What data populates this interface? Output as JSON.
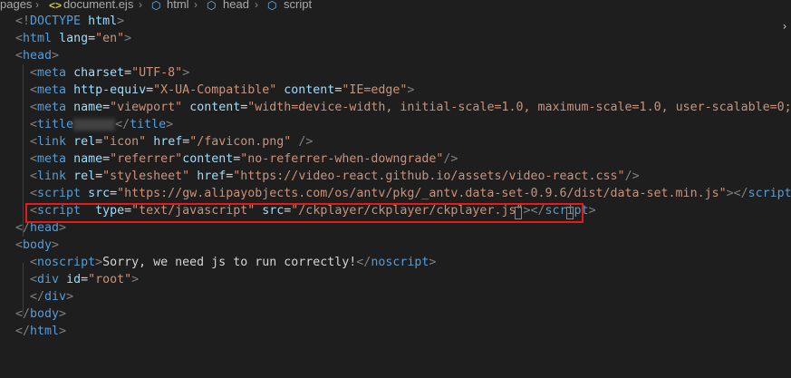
{
  "breadcrumb": {
    "items": [
      "pages",
      "document.ejs",
      "html",
      "head",
      "script"
    ],
    "separator": "›"
  },
  "code_lines": [
    [
      [
        "t-punct",
        "<!"
      ],
      [
        "t-tag",
        "DOCTYPE"
      ],
      [
        "t-text",
        " "
      ],
      [
        "t-attr",
        "html"
      ],
      [
        "t-punct",
        ">"
      ]
    ],
    [
      [
        "t-punct",
        "<"
      ],
      [
        "t-tag",
        "html"
      ],
      [
        "t-text",
        " "
      ],
      [
        "t-attr",
        "lang"
      ],
      [
        "t-text",
        "="
      ],
      [
        "t-str",
        "\"en\""
      ],
      [
        "t-punct",
        ">"
      ]
    ],
    [
      [
        "t-punct",
        "<"
      ],
      [
        "t-tag",
        "head"
      ],
      [
        "t-punct",
        ">"
      ]
    ],
    [
      [
        "t-text",
        "  "
      ],
      [
        "t-punct",
        "<"
      ],
      [
        "t-tag",
        "meta"
      ],
      [
        "t-text",
        " "
      ],
      [
        "t-attr",
        "charset"
      ],
      [
        "t-text",
        "="
      ],
      [
        "t-str",
        "\"UTF-8\""
      ],
      [
        "t-punct",
        ">"
      ]
    ],
    [
      [
        "t-text",
        "  "
      ],
      [
        "t-punct",
        "<"
      ],
      [
        "t-tag",
        "meta"
      ],
      [
        "t-text",
        " "
      ],
      [
        "t-attr",
        "http-equiv"
      ],
      [
        "t-text",
        "="
      ],
      [
        "t-str",
        "\"X-UA-Compatible\""
      ],
      [
        "t-text",
        " "
      ],
      [
        "t-attr",
        "content"
      ],
      [
        "t-text",
        "="
      ],
      [
        "t-str",
        "\"IE=edge\""
      ],
      [
        "t-punct",
        ">"
      ]
    ],
    [
      [
        "t-text",
        "  "
      ],
      [
        "t-punct",
        "<"
      ],
      [
        "t-tag",
        "meta"
      ],
      [
        "t-text",
        " "
      ],
      [
        "t-attr",
        "name"
      ],
      [
        "t-text",
        "="
      ],
      [
        "t-str",
        "\"viewport\""
      ],
      [
        "t-text",
        " "
      ],
      [
        "t-attr",
        "content"
      ],
      [
        "t-text",
        "="
      ],
      [
        "t-str",
        "\"width=device-width, initial-scale=1.0, maximum-scale=1.0, user-scalable=0;\""
      ],
      [
        "t-punct",
        ">"
      ]
    ],
    [
      [
        "t-text",
        "  "
      ],
      [
        "t-punct",
        "<"
      ],
      [
        "t-tag",
        "title"
      ],
      [
        "blur",
        ""
      ],
      [
        "t-punct",
        "</"
      ],
      [
        "t-tag",
        "title"
      ],
      [
        "t-punct",
        ">"
      ]
    ],
    [
      [
        "t-text",
        "  "
      ],
      [
        "t-punct",
        "<"
      ],
      [
        "t-tag",
        "link"
      ],
      [
        "t-text",
        " "
      ],
      [
        "t-attr",
        "rel"
      ],
      [
        "t-text",
        "="
      ],
      [
        "t-str",
        "\"icon\""
      ],
      [
        "t-text",
        " "
      ],
      [
        "t-attr",
        "href"
      ],
      [
        "t-text",
        "="
      ],
      [
        "t-str",
        "\"/favicon.png\""
      ],
      [
        "t-text",
        " "
      ],
      [
        "t-punct",
        "/>"
      ]
    ],
    [
      [
        "t-text",
        "  "
      ],
      [
        "t-punct",
        "<"
      ],
      [
        "t-tag",
        "meta"
      ],
      [
        "t-text",
        " "
      ],
      [
        "t-attr",
        "name"
      ],
      [
        "t-text",
        "="
      ],
      [
        "t-str",
        "\"referrer\""
      ],
      [
        "t-attr",
        "content"
      ],
      [
        "t-text",
        "="
      ],
      [
        "t-str",
        "\"no-referrer-when-downgrade\""
      ],
      [
        "t-punct",
        "/>"
      ]
    ],
    [
      [
        "t-text",
        "  "
      ],
      [
        "t-punct",
        "<"
      ],
      [
        "t-tag",
        "link"
      ],
      [
        "t-text",
        " "
      ],
      [
        "t-attr",
        "rel"
      ],
      [
        "t-text",
        "="
      ],
      [
        "t-str",
        "\"stylesheet\""
      ],
      [
        "t-text",
        " "
      ],
      [
        "t-attr",
        "href"
      ],
      [
        "t-text",
        "="
      ],
      [
        "t-str",
        "\"https://video-react.github.io/assets/video-react.css\""
      ],
      [
        "t-punct",
        "/>"
      ]
    ],
    [
      [
        "t-text",
        "  "
      ],
      [
        "t-punct",
        "<"
      ],
      [
        "t-tag",
        "script"
      ],
      [
        "t-text",
        " "
      ],
      [
        "t-attr",
        "src"
      ],
      [
        "t-text",
        "="
      ],
      [
        "t-str",
        "\"https://gw.alipayobjects.com/os/antv/pkg/_antv.data-set-0.9.6/dist/data-set.min.js\""
      ],
      [
        "t-punct",
        "></"
      ],
      [
        "t-tag",
        "script"
      ],
      [
        "t-punct",
        ">"
      ]
    ],
    [
      [
        "t-text",
        "  "
      ],
      [
        "t-punct",
        "<"
      ],
      [
        "t-tag",
        "script"
      ],
      [
        "t-text",
        "  "
      ],
      [
        "t-attr",
        "type"
      ],
      [
        "t-text",
        "="
      ],
      [
        "t-str",
        "\"text/javascript\""
      ],
      [
        "t-text",
        " "
      ],
      [
        "t-attr",
        "src"
      ],
      [
        "t-text",
        "="
      ],
      [
        "t-str",
        "\"/ckplayer/ckplayer/ckplayer.js\""
      ],
      [
        "t-punct",
        "></"
      ],
      [
        "t-tag",
        "script"
      ],
      [
        "t-punct",
        ">"
      ]
    ],
    [
      [
        "t-punct",
        "</"
      ],
      [
        "t-tag",
        "head"
      ],
      [
        "t-punct",
        ">"
      ]
    ],
    [
      [
        "t-punct",
        "<"
      ],
      [
        "t-tag",
        "body"
      ],
      [
        "t-punct",
        ">"
      ]
    ],
    [
      [
        "t-text",
        "  "
      ],
      [
        "t-punct",
        "<"
      ],
      [
        "t-tag",
        "noscript"
      ],
      [
        "t-punct",
        ">"
      ],
      [
        "t-text",
        "Sorry, we need js to run correctly!"
      ],
      [
        "t-punct",
        "</"
      ],
      [
        "t-tag",
        "noscript"
      ],
      [
        "t-punct",
        ">"
      ]
    ],
    [
      [
        "t-text",
        "  "
      ],
      [
        "t-punct",
        "<"
      ],
      [
        "t-tag",
        "div"
      ],
      [
        "t-text",
        " "
      ],
      [
        "t-attr",
        "id"
      ],
      [
        "t-text",
        "="
      ],
      [
        "t-str",
        "\"root\""
      ],
      [
        "t-punct",
        ">"
      ]
    ],
    [
      [
        "t-text",
        "  "
      ],
      [
        "t-punct",
        "</"
      ],
      [
        "t-tag",
        "div"
      ],
      [
        "t-punct",
        ">"
      ]
    ],
    [
      [
        "t-punct",
        "</"
      ],
      [
        "t-tag",
        "body"
      ],
      [
        "t-punct",
        ">"
      ]
    ],
    [
      [
        "t-punct",
        "</"
      ],
      [
        "t-tag",
        "html"
      ],
      [
        "t-punct",
        ">"
      ]
    ]
  ],
  "colors": {
    "background": "#1e1e1e",
    "tag": "#569cd6",
    "attribute": "#9cdcfe",
    "string": "#ce9178",
    "punctuation": "#808080",
    "highlight_box": "#e51a1a"
  }
}
